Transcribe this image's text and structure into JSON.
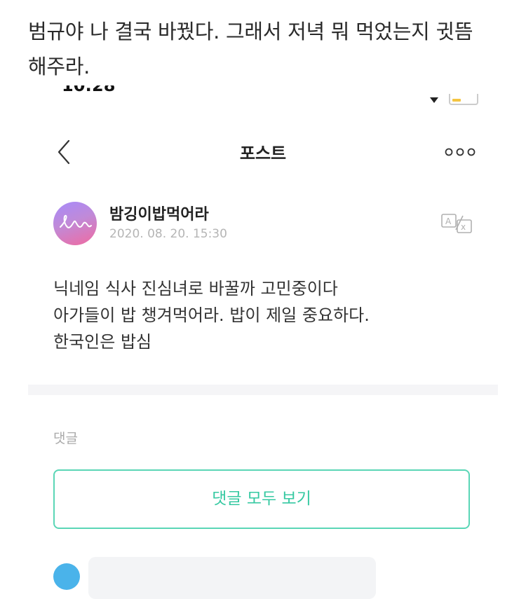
{
  "caption": {
    "line1": "범규야 나 결국 바꿨다. 그래서 저녁 뭐 먹었는지 귓뜸",
    "line2": "해주라."
  },
  "status_bar": {
    "time": "10:28",
    "icons": [
      "signal-icon",
      "wifi-icon",
      "battery-icon"
    ],
    "battery_color": "#f4c542"
  },
  "nav": {
    "title": "포스트",
    "back_icon": "chevron-left-icon",
    "more_icon": "more-dots-icon"
  },
  "post": {
    "author": "밤깅이밥먹어라",
    "date": "2020. 08. 20. 15:30",
    "translate_icon": "translate-icon",
    "avatar_colors": [
      "#a78bfa",
      "#f06aa0"
    ],
    "lines": [
      "닉네임 식사 진심녀로 바꿀까 고민중이다",
      "아가들이 밥 챙겨먹어라. 밥이 제일 중요하다.",
      "한국인은 밥심"
    ]
  },
  "comments": {
    "label": "댓글",
    "view_all_label": "댓글 모두 보기",
    "accent_color": "#36c9a2"
  }
}
